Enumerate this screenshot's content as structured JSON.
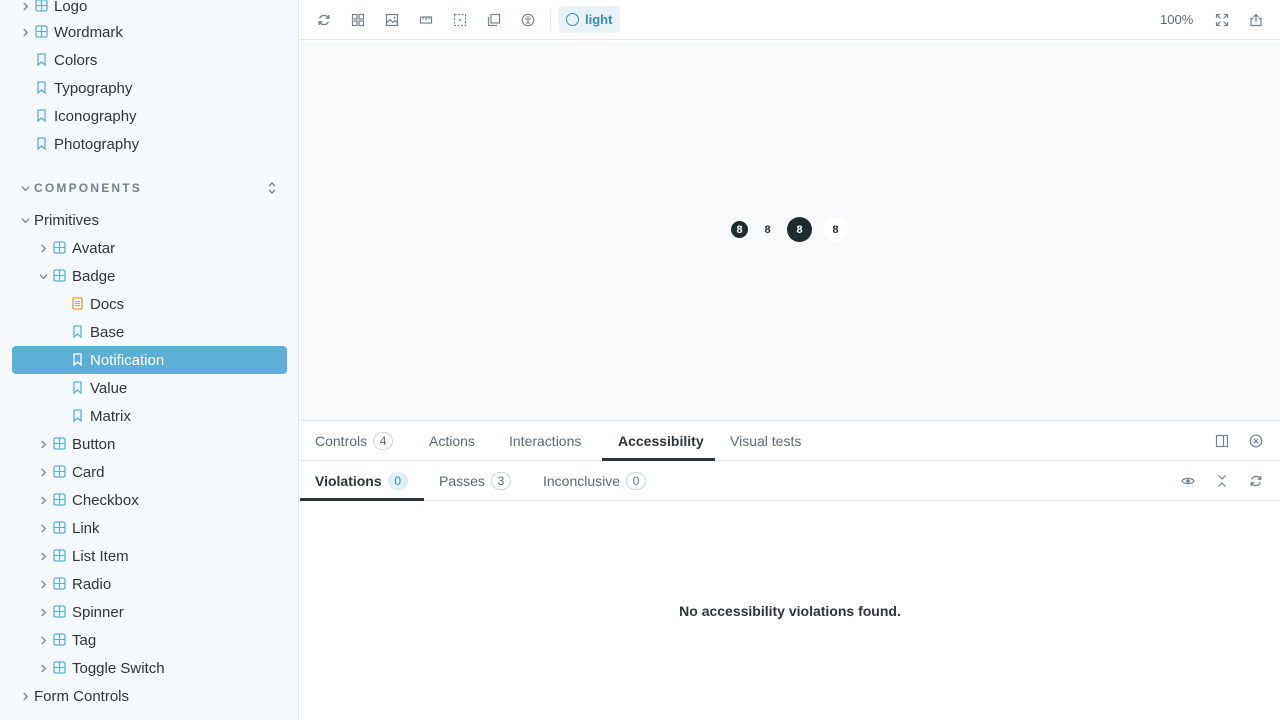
{
  "sidebar": {
    "top_items": [
      {
        "label": "Logo",
        "icon": "component-icon",
        "expandable": true
      },
      {
        "label": "Wordmark",
        "icon": "component-icon",
        "expandable": true
      },
      {
        "label": "Colors",
        "icon": "bookmark-icon",
        "expandable": false
      },
      {
        "label": "Typography",
        "icon": "bookmark-icon",
        "expandable": false
      },
      {
        "label": "Iconography",
        "icon": "bookmark-icon",
        "expandable": false
      },
      {
        "label": "Photography",
        "icon": "bookmark-icon",
        "expandable": false
      }
    ],
    "section": {
      "title": "COMPONENTS"
    },
    "tree": [
      {
        "label": "Primitives",
        "type": "folder",
        "expanded": true
      },
      {
        "label": "Avatar",
        "type": "component"
      },
      {
        "label": "Badge",
        "type": "component",
        "expanded": true
      },
      {
        "label": "Docs",
        "type": "docs"
      },
      {
        "label": "Base",
        "type": "story"
      },
      {
        "label": "Notification",
        "type": "story",
        "selected": true
      },
      {
        "label": "Value",
        "type": "story"
      },
      {
        "label": "Matrix",
        "type": "story"
      },
      {
        "label": "Button",
        "type": "component"
      },
      {
        "label": "Card",
        "type": "component"
      },
      {
        "label": "Checkbox",
        "type": "component"
      },
      {
        "label": "Link",
        "type": "component"
      },
      {
        "label": "List Item",
        "type": "component"
      },
      {
        "label": "Radio",
        "type": "component"
      },
      {
        "label": "Spinner",
        "type": "component"
      },
      {
        "label": "Tag",
        "type": "component"
      },
      {
        "label": "Toggle Switch",
        "type": "component"
      },
      {
        "label": "Form Controls",
        "type": "folder"
      }
    ]
  },
  "toolbar": {
    "tools": [
      "reload-icon",
      "grid-icon",
      "image-icon",
      "ruler-icon",
      "outline-icon",
      "layers-icon",
      "accessibility-icon"
    ],
    "theme_label": "light",
    "zoom": "100%",
    "right_tools": [
      "fullscreen-icon",
      "share-icon"
    ]
  },
  "canvas": {
    "badges": [
      "8",
      "8",
      "8",
      "8"
    ]
  },
  "addons": {
    "tabs": [
      {
        "label": "Controls",
        "count": "4"
      },
      {
        "label": "Actions",
        "count": ""
      },
      {
        "label": "Interactions",
        "count": ""
      },
      {
        "label": "Accessibility",
        "count": "",
        "active": true
      },
      {
        "label": "Visual tests",
        "count": ""
      }
    ],
    "subtabs": [
      {
        "label": "Violations",
        "count": "0",
        "active": true
      },
      {
        "label": "Passes",
        "count": "3"
      },
      {
        "label": "Inconclusive",
        "count": "0"
      }
    ],
    "message": "No accessibility violations found."
  },
  "colors": {
    "accent": "#5cb0d6",
    "sidebar_bg": "#f6f9fc",
    "text": "#2e3438",
    "badge_dark": "#1f2a30"
  }
}
